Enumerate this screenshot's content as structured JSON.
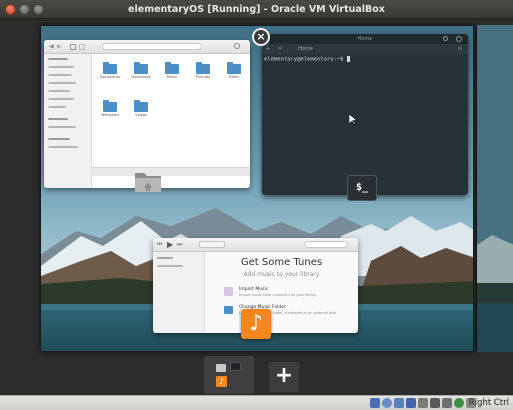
{
  "window": {
    "title": "elementaryOS [Running] - Oracle VM VirtualBox"
  },
  "terminal": {
    "title": "Home",
    "tab_label": "Home",
    "prompt": "elementary@elementary:~$ ",
    "badge_text": "$_"
  },
  "files": {
    "items": [
      {
        "label": "Documents"
      },
      {
        "label": "Downloads"
      },
      {
        "label": "Music"
      },
      {
        "label": "Pictures"
      },
      {
        "label": "Public"
      },
      {
        "label": "Templates"
      },
      {
        "label": "Videos"
      }
    ],
    "icon": "folder-icon"
  },
  "music": {
    "heading": "Get Some Tunes",
    "subheading": "Add music to your library",
    "options": [
      {
        "title": "Import Music",
        "description": "Import music from a source into your library"
      },
      {
        "title": "Change Music Folder",
        "description": "Load music from a folder, a network or an external disk"
      }
    ],
    "badge_icon": "music-note-icon"
  },
  "switcher": {
    "add_label": "+"
  },
  "statusbar": {
    "host_key": "Right Ctrl"
  },
  "colors": {
    "accent_orange": "#f7861e",
    "folder_blue": "#4b8fc6",
    "terminal_bg": "#273238"
  }
}
